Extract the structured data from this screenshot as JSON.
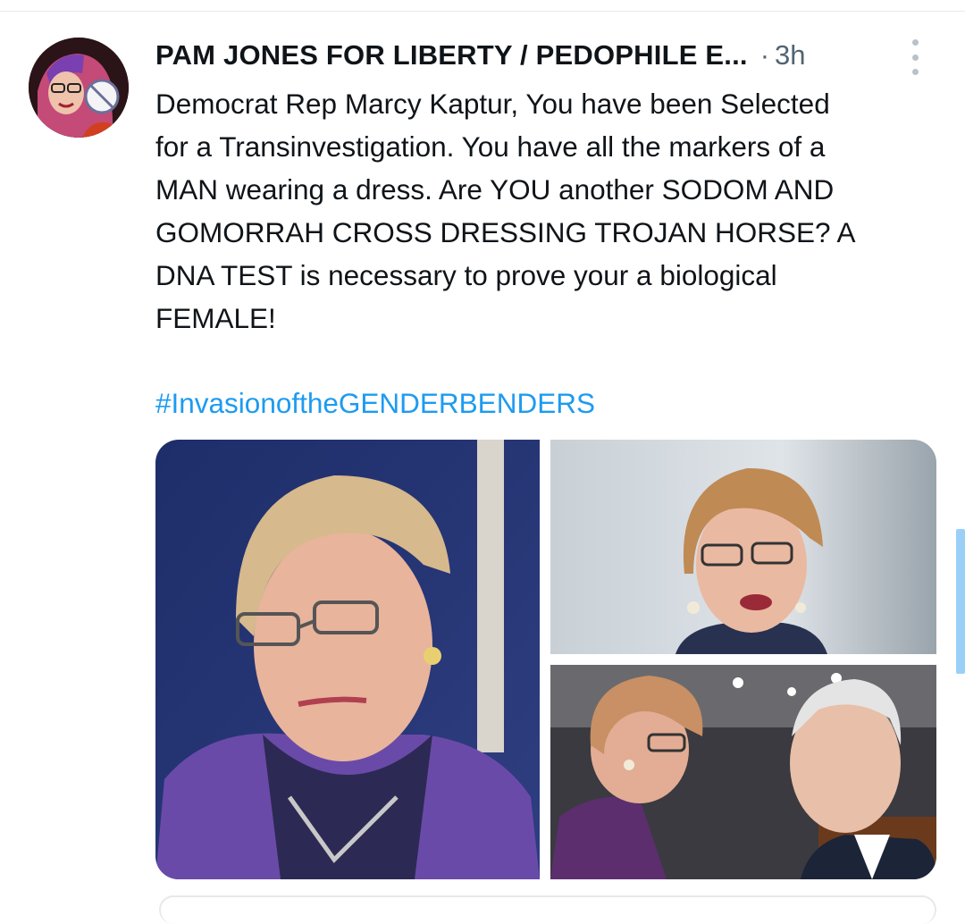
{
  "tweet": {
    "author_display_name": "PAM JONES FOR LIBERTY / PEDOPHILE E...",
    "separator": "·",
    "timestamp": "3h",
    "text": "Democrat Rep Marcy Kaptur, You have been Selected\nfor a Transinvestigation. You have all the markers of a\nMAN wearing a dress. Are YOU another SODOM AND\nGOMORRAH CROSS DRESSING TROJAN HORSE? A\nDNA TEST is necessary to prove your a biological\nFEMALE!",
    "hashtag": "#InvasionoftheGENDERBENDERS",
    "media_count": 3
  },
  "icons": {
    "more": "more-vertical-icon"
  },
  "colors": {
    "link": "#1d9bf0",
    "muted": "#536471",
    "text": "#0f1419",
    "scroll": "#9ad0f7"
  }
}
